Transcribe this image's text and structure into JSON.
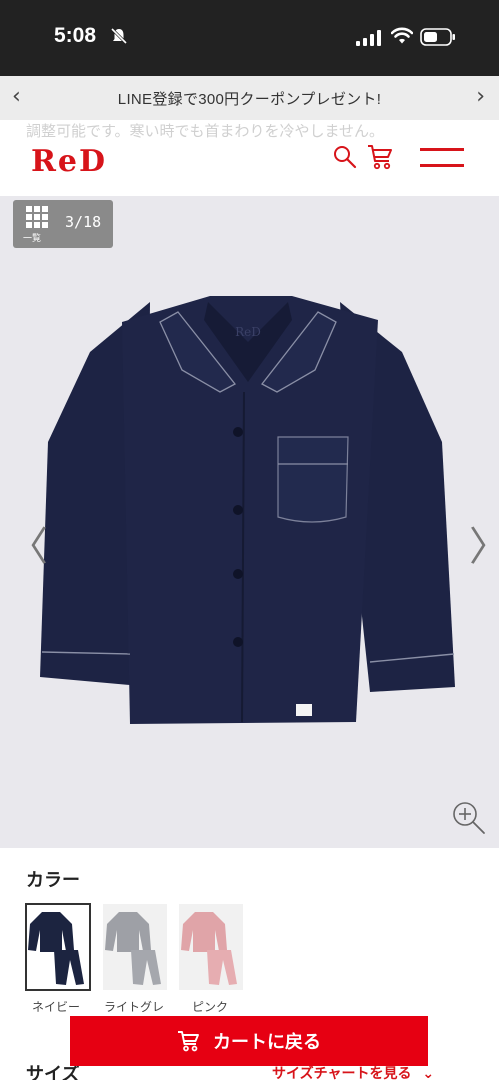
{
  "status_bar": {
    "time": "5:08"
  },
  "promo": {
    "text": "LINE登録で300円クーポンプレゼント!",
    "prev_glyph": "‹",
    "next_glyph": "›"
  },
  "header": {
    "ghost_text": "調整可能です。寒い時でも首まわりを冷やしません。",
    "logo": "ReD",
    "brand_color": "#d7141a"
  },
  "gallery": {
    "grid_label": "一覧",
    "counter": "3/18",
    "prev_glyph": "〈",
    "next_glyph": "〉",
    "image_alt_logo": "ReD"
  },
  "color_section": {
    "heading": "カラー",
    "swatches": [
      {
        "label": "ネイビー",
        "color": "#1c2440",
        "selected": true
      },
      {
        "label": "ライトグレ",
        "color": "#9ea0a6",
        "selected": false
      },
      {
        "label": "ピンク",
        "color": "#e0a4a8",
        "selected": false
      }
    ]
  },
  "size_section": {
    "heading": "サイズ",
    "chart_link": "サイズチャートを見る"
  },
  "cart_button": {
    "label": "カートに戻る",
    "color": "#e60012"
  }
}
